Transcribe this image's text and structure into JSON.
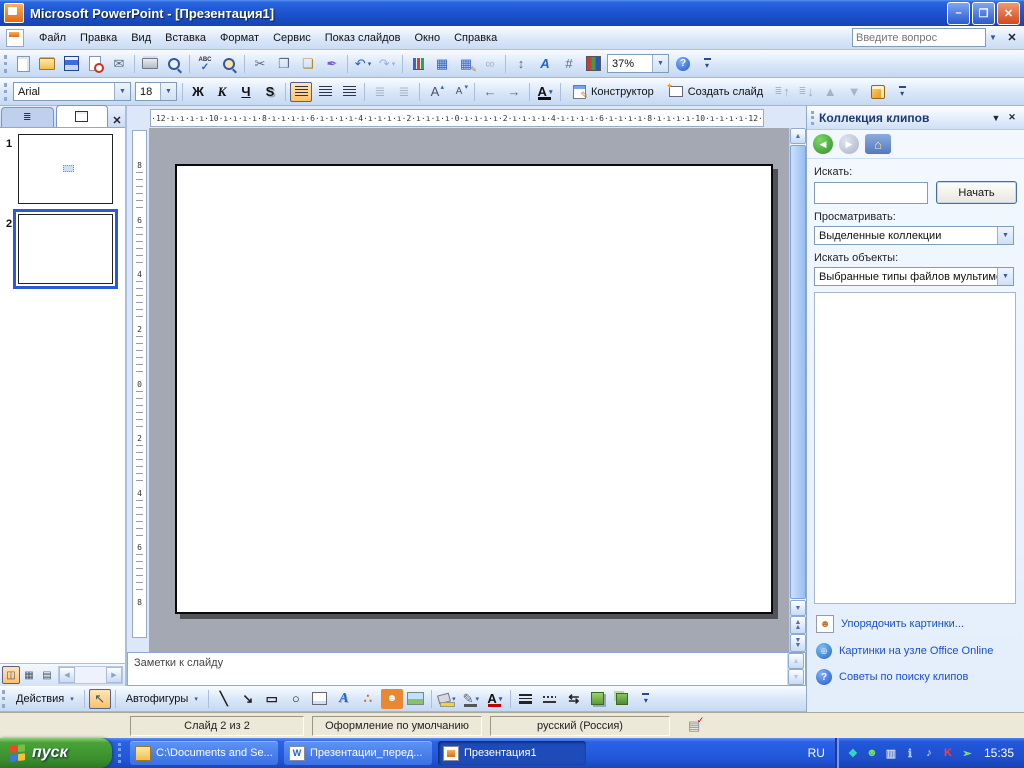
{
  "window": {
    "title": "Microsoft PowerPoint - [Презентация1]"
  },
  "menu": {
    "items": [
      "Файл",
      "Правка",
      "Вид",
      "Вставка",
      "Формат",
      "Сервис",
      "Показ слайдов",
      "Окно",
      "Справка"
    ],
    "question_placeholder": "Введите вопрос"
  },
  "standard": {
    "zoom_value": "37%",
    "icons": [
      {
        "n": "new-document-icon",
        "c": "i-page"
      },
      {
        "n": "open-icon",
        "c": "i-folder"
      },
      {
        "n": "save-icon",
        "c": "i-floppy"
      },
      {
        "n": "permission-icon",
        "c": "i-perm"
      },
      {
        "n": "mail-recipient-icon",
        "g": "✉",
        "c": "g-steel"
      },
      {
        "sep": true
      },
      {
        "n": "print-icon",
        "c": "i-print"
      },
      {
        "n": "print-preview-icon",
        "c": "i-mag"
      },
      {
        "sep": true
      },
      {
        "n": "spelling-icon",
        "g": "✓",
        "c": "i-spell"
      },
      {
        "n": "research-icon",
        "c": "i-mag i-mag-book"
      },
      {
        "sep": true
      },
      {
        "n": "cut-icon",
        "g": "✂",
        "c": "g-steel"
      },
      {
        "n": "copy-icon",
        "g": "❐",
        "c": "g-steel"
      },
      {
        "n": "paste-icon",
        "g": "❏",
        "c": "g-amber"
      },
      {
        "n": "format-painter-icon",
        "g": "✒",
        "c": "g-brush"
      },
      {
        "sep": true
      },
      {
        "n": "undo-icon",
        "g": "↶",
        "c": "g-blue",
        "dd": true
      },
      {
        "n": "redo-icon",
        "g": "↷",
        "c": "g-blue",
        "dd": true,
        "dis": true
      },
      {
        "sep": true
      },
      {
        "n": "insert-chart-icon",
        "c": "i-chart"
      },
      {
        "n": "insert-table-icon",
        "g": "▦",
        "c": "g-blue"
      },
      {
        "n": "tables-borders-icon",
        "g": "▦",
        "c": "i-tbl2"
      },
      {
        "n": "hyperlink-icon",
        "g": "∞",
        "c": "g-steel",
        "dis": true
      },
      {
        "sep": true
      },
      {
        "n": "expand-all-icon",
        "g": "↕",
        "c": "g-steel"
      },
      {
        "n": "show-formatting-icon",
        "g": "A",
        "c": "i-showfmt"
      },
      {
        "n": "grid-icon",
        "g": "#",
        "c": "g-steel"
      },
      {
        "n": "color-grayscale-icon",
        "c": "i-rgb"
      }
    ],
    "icons2": [
      {
        "n": "help-icon",
        "c": "i-help"
      },
      {
        "n": "toolbar-options-icon",
        "g": "▾",
        "c": "i-chev"
      }
    ]
  },
  "formatting": {
    "font_name": "Arial",
    "font_size": "18",
    "designer_label": "Конструктор",
    "new_slide_label": "Создать слайд",
    "icons1": [
      {
        "n": "bold-button",
        "g": "Ж",
        "c": "f-bold"
      },
      {
        "n": "italic-button",
        "g": "К",
        "c": "f-italic"
      },
      {
        "n": "underline-button",
        "g": "Ч",
        "c": "f-under"
      },
      {
        "n": "shadow-button",
        "g": "S",
        "c": "f-shadow"
      },
      {
        "sep": true
      },
      {
        "n": "align-left-button",
        "c": "i-al",
        "act": true
      },
      {
        "n": "align-center-button",
        "c": "i-ac"
      },
      {
        "n": "align-right-button",
        "c": "i-ar"
      },
      {
        "sep": true
      },
      {
        "n": "numbered-list-button",
        "g": "≣",
        "c": "g-steel",
        "dis": true
      },
      {
        "n": "bulleted-list-button",
        "g": "≣",
        "c": "g-steel",
        "dis": true
      },
      {
        "sep": true
      },
      {
        "n": "increase-font-button",
        "g": "A",
        "c": "i-fontup"
      },
      {
        "n": "decrease-font-button",
        "g": "A",
        "c": "i-fontdown"
      },
      {
        "sep": true
      },
      {
        "n": "decrease-indent-button",
        "g": "←",
        "c": "g-steel"
      },
      {
        "n": "increase-indent-button",
        "g": "→",
        "c": "g-steel"
      },
      {
        "sep": true
      },
      {
        "n": "font-color-button",
        "g": "A",
        "c": "i-fontcolor",
        "dd": true
      },
      {
        "sep": true
      }
    ],
    "icons2": [
      {
        "n": "move-up-list-button",
        "g": "↑",
        "c": "i-mv",
        "dis": true
      },
      {
        "n": "move-down-list-button",
        "g": "↓",
        "c": "i-mv",
        "dis": true
      },
      {
        "n": "promote-button",
        "g": "▲",
        "c": "g-steel",
        "dis": true
      },
      {
        "n": "demote-button",
        "g": "▼",
        "c": "g-steel",
        "dis": true
      },
      {
        "n": "slide-design-icon",
        "c": "i-bucket2"
      },
      {
        "n": "toolbar-options-icon",
        "g": "▾",
        "c": "i-chev"
      }
    ]
  },
  "slides_panel": {
    "slides": [
      {
        "num": "1",
        "mark": true,
        "selected": false
      },
      {
        "num": "2",
        "mark": false,
        "selected": true
      }
    ],
    "view_buttons": [
      {
        "n": "normal-view-button",
        "g": "◫",
        "act": true
      },
      {
        "n": "slide-sorter-button",
        "g": "▦"
      },
      {
        "n": "slideshow-button",
        "g": "▤"
      }
    ]
  },
  "rulers": {
    "horizontal": [
      "12",
      "10",
      "8",
      "6",
      "4",
      "2",
      "0",
      "2",
      "4",
      "6",
      "8",
      "10",
      "12"
    ],
    "vertical": [
      "8",
      "6",
      "4",
      "2",
      "0",
      "2",
      "4",
      "6",
      "8"
    ]
  },
  "notes": {
    "placeholder": "Заметки к слайду"
  },
  "drawing": {
    "actions_label": "Действия",
    "autoshapes_label": "Автофигуры",
    "select_icon": {
      "n": "select-objects-icon",
      "g": "↖",
      "act": true
    },
    "icons": [
      {
        "n": "line-icon",
        "g": "╲",
        "c": "g-dark"
      },
      {
        "n": "arrow-icon",
        "g": "↘",
        "c": "g-dark"
      },
      {
        "n": "rectangle-icon",
        "g": "▭",
        "c": "g-dark"
      },
      {
        "n": "oval-icon",
        "g": "○",
        "c": "g-dark"
      },
      {
        "n": "text-box-icon",
        "c": "i-textbox"
      },
      {
        "n": "wordart-icon",
        "g": "A",
        "c": "i-wordart"
      },
      {
        "n": "diagram-icon",
        "g": "∴",
        "c": "i-diagram"
      },
      {
        "n": "clipart-icon",
        "g": "☻",
        "c": "i-clipart"
      },
      {
        "n": "picture-icon",
        "c": "i-picture"
      },
      {
        "sep": true
      },
      {
        "n": "fill-color-icon",
        "c": "i-fill",
        "dd": true
      },
      {
        "n": "line-color-icon",
        "g": "✎",
        "c": "i-linecolor",
        "dd": true
      },
      {
        "n": "font-color-icon",
        "g": "A",
        "c": "i-fontcolor2",
        "dd": true
      },
      {
        "sep": true
      },
      {
        "n": "line-style-icon",
        "c": "i-linestyle"
      },
      {
        "n": "dash-style-icon",
        "c": "i-dashstyle"
      },
      {
        "n": "arrow-style-icon",
        "g": "⇆",
        "c": "g-dark"
      },
      {
        "n": "shadow-style-icon",
        "c": "i-shadowsq"
      },
      {
        "n": "3d-style-icon",
        "c": "i-3d"
      },
      {
        "n": "toolbar-options-icon",
        "g": "▾",
        "c": "i-chev"
      }
    ]
  },
  "task_pane": {
    "title": "Коллекция клипов",
    "nav": [
      {
        "n": "back-button",
        "g": "◀",
        "c": "nav-back"
      },
      {
        "n": "forward-button",
        "g": "▶",
        "c": "nav-fwd",
        "dis": true
      },
      {
        "n": "home-button",
        "g": "⌂",
        "c": "nav-home"
      }
    ],
    "search_label": "Искать:",
    "search_button": "Начать",
    "browse_label": "Просматривать:",
    "browse_value": "Выделенные коллекции",
    "media_label": "Искать объекты:",
    "media_value": "Выбранные типы файлов мультиме",
    "links": [
      {
        "n": "organize-clips-link",
        "c": "lk-org",
        "g": "☻",
        "label": "Упорядочить картинки..."
      },
      {
        "n": "office-online-link",
        "c": "lk-globe",
        "g": "⊕",
        "label": "Картинки на узле Office Online"
      },
      {
        "n": "search-tips-link",
        "c": "lk-help",
        "g": "?",
        "label": "Советы по поиску клипов"
      }
    ]
  },
  "status_bar": {
    "slide": "Слайд 2 из 2",
    "design": "Оформление по умолчанию",
    "language": "русский (Россия)"
  },
  "taskbar": {
    "start_label": "пуск",
    "tasks": [
      {
        "label": "C:\\Documents and Se...",
        "icon": "folder",
        "active": false
      },
      {
        "label": "Презентации_перед...",
        "icon": "word",
        "active": false
      },
      {
        "label": "Презентация1",
        "icon": "ppt",
        "active": true
      }
    ],
    "language": "RU",
    "time": "15:35",
    "tray": [
      {
        "n": "tray-icon-agent",
        "g": "❖",
        "color": "#35d8b8"
      },
      {
        "n": "tray-icon-messenger",
        "g": "☻",
        "color": "#6ee84e"
      },
      {
        "n": "tray-icon-network",
        "g": "▥",
        "color": "#cfd8ea"
      },
      {
        "n": "tray-icon-info",
        "g": "ℹ",
        "color": "#aac8f8"
      },
      {
        "n": "tray-icon-volume",
        "g": "♪",
        "color": "#dce0ea"
      },
      {
        "n": "tray-icon-kaspersky",
        "g": "K",
        "color": "#ff4030"
      },
      {
        "n": "tray-icon-update",
        "g": "➢",
        "color": "#8ae870"
      }
    ]
  }
}
